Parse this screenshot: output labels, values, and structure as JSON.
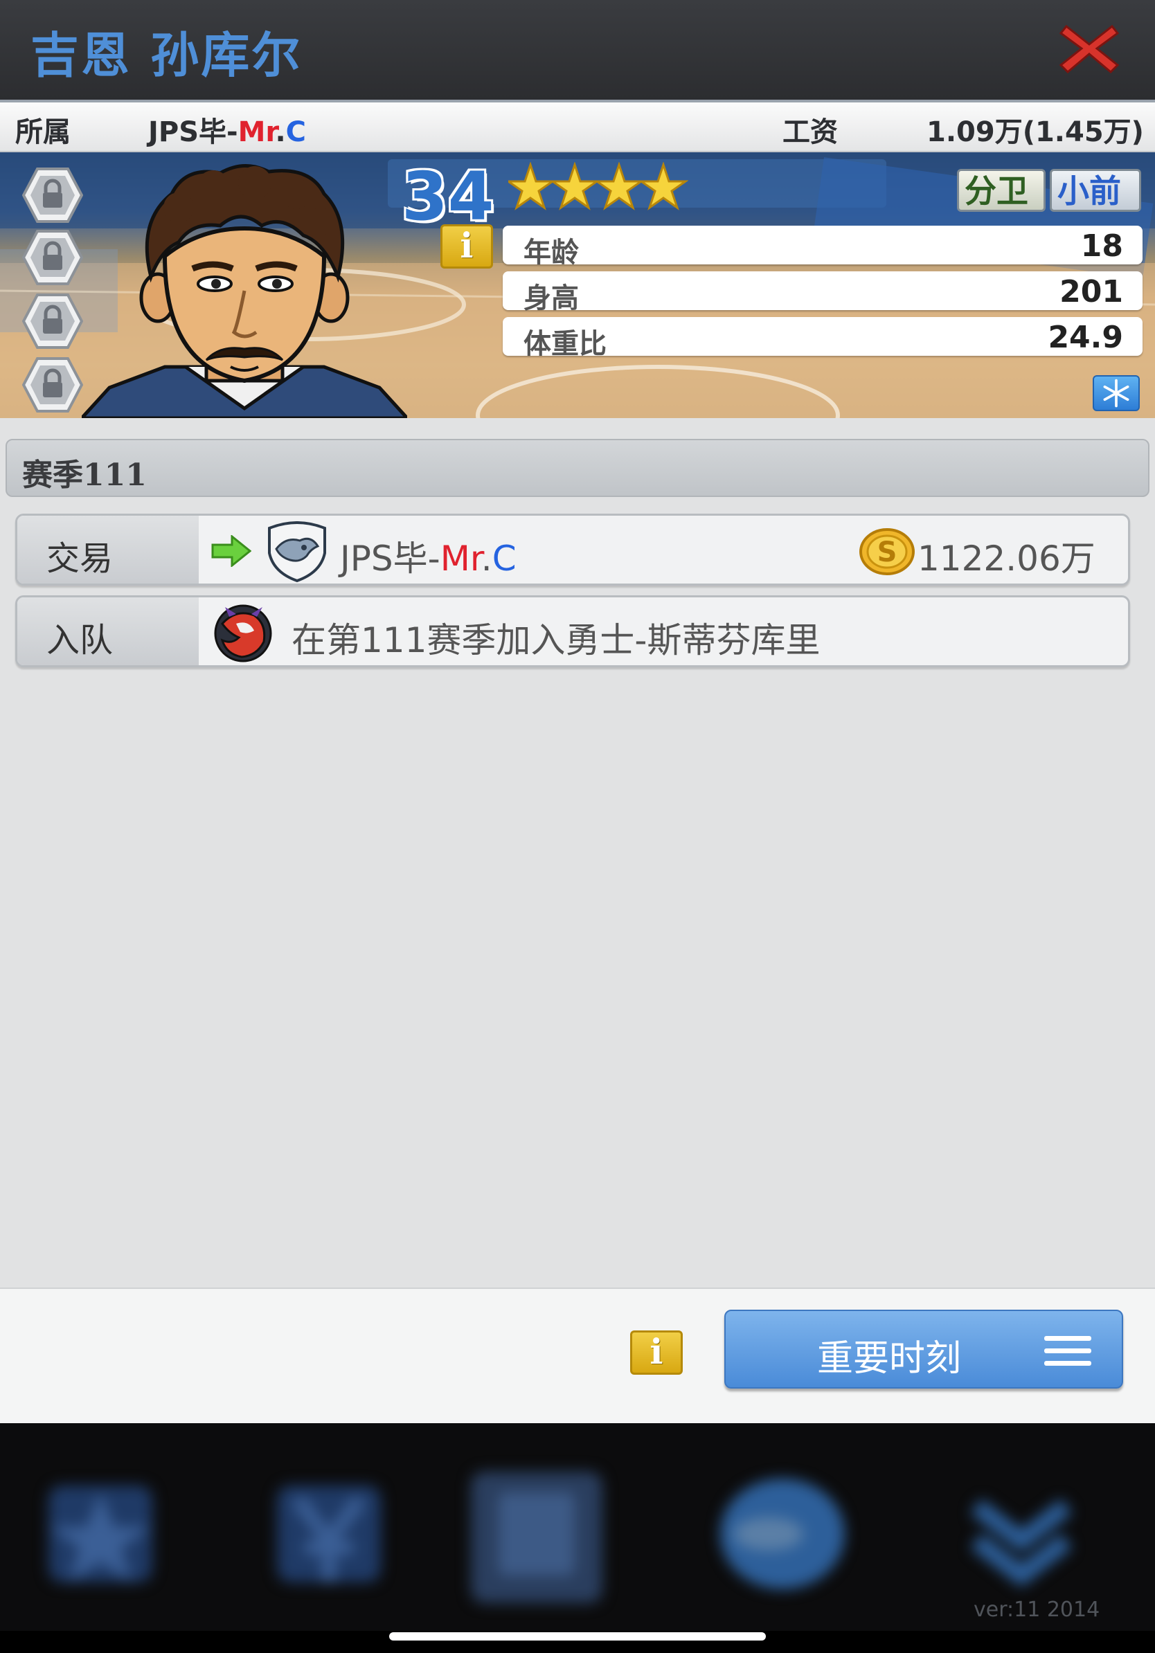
{
  "player": {
    "name": "吉恩 孙库尔",
    "team_label": "所属",
    "team_name_prefix": "JPS毕-",
    "team_name_mr": "Mr",
    "team_name_dot": ".",
    "team_name_c": "C",
    "salary_label": "工资",
    "salary_value": "1.09万(1.45万)",
    "rating": "34",
    "stars": 4,
    "positions": [
      "分卫",
      "小前"
    ],
    "stats": [
      {
        "label": "年龄",
        "value": "18"
      },
      {
        "label": "身高",
        "value": "201"
      },
      {
        "label": "体重比",
        "value": "24.9"
      }
    ]
  },
  "history": {
    "season_title": "赛季111",
    "rows": [
      {
        "type": "交易",
        "team_prefix": "JPS毕-",
        "team_mr": "Mr",
        "team_dot": ".",
        "team_c": "C",
        "price": "1122.06万"
      },
      {
        "type": "入队",
        "text": "在第111赛季加入勇士-斯蒂芬库里"
      }
    ]
  },
  "footer": {
    "moments_label": "重要时刻"
  },
  "nav": {
    "version": "ver:11  2014"
  },
  "icons": [
    "close-icon",
    "lock-icon",
    "star-icon",
    "info-icon",
    "freeze-icon",
    "arrow-right-icon",
    "team-logo-icon",
    "coin-icon",
    "menu-icon"
  ],
  "colors": {
    "title": "#4f8fd8",
    "accent_red": "#e0222e",
    "accent_blue": "#2563e0",
    "button": "#4a8bd8"
  }
}
